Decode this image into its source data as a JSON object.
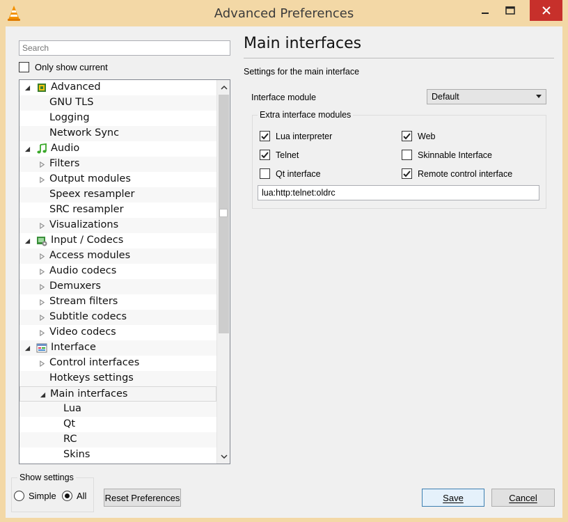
{
  "window": {
    "title": "Advanced Preferences",
    "colors": {
      "frame": "#f3d8a6",
      "close": "#c7302b",
      "accent": "#3c7fb1"
    }
  },
  "left": {
    "search_placeholder": "Search",
    "only_show_current": {
      "label": "Only show current",
      "checked": false
    },
    "tree": [
      {
        "label": "Advanced",
        "level": 0,
        "expanded": true,
        "icon": "chip-icon"
      },
      {
        "label": "GNU TLS",
        "level": 1
      },
      {
        "label": "Logging",
        "level": 1
      },
      {
        "label": "Network Sync",
        "level": 1
      },
      {
        "label": "Audio",
        "level": 0,
        "expanded": true,
        "icon": "music-note-icon"
      },
      {
        "label": "Filters",
        "level": 1,
        "collapsed": true
      },
      {
        "label": "Output modules",
        "level": 1,
        "collapsed": true
      },
      {
        "label": "Speex resampler",
        "level": 1
      },
      {
        "label": "SRC resampler",
        "level": 1
      },
      {
        "label": "Visualizations",
        "level": 1,
        "collapsed": true
      },
      {
        "label": "Input / Codecs",
        "level": 0,
        "expanded": true,
        "icon": "codec-icon"
      },
      {
        "label": "Access modules",
        "level": 1,
        "collapsed": true
      },
      {
        "label": "Audio codecs",
        "level": 1,
        "collapsed": true
      },
      {
        "label": "Demuxers",
        "level": 1,
        "collapsed": true
      },
      {
        "label": "Stream filters",
        "level": 1,
        "collapsed": true
      },
      {
        "label": "Subtitle codecs",
        "level": 1,
        "collapsed": true
      },
      {
        "label": "Video codecs",
        "level": 1,
        "collapsed": true
      },
      {
        "label": "Interface",
        "level": 0,
        "expanded": true,
        "icon": "interface-icon"
      },
      {
        "label": "Control interfaces",
        "level": 1,
        "collapsed": true
      },
      {
        "label": "Hotkeys settings",
        "level": 1
      },
      {
        "label": "Main interfaces",
        "level": 1,
        "expanded": true,
        "selected": true
      },
      {
        "label": "Lua",
        "level": 2
      },
      {
        "label": "Qt",
        "level": 2
      },
      {
        "label": "RC",
        "level": 2
      },
      {
        "label": "Skins",
        "level": 2
      }
    ],
    "show_settings": {
      "legend": "Show settings",
      "simple": {
        "label": "Simple",
        "selected": false
      },
      "all": {
        "label": "All",
        "selected": true
      }
    },
    "reset_button": "Reset Preferences"
  },
  "right": {
    "title": "Main interfaces",
    "subtitle": "Settings for the main interface",
    "interface_module": {
      "label": "Interface module",
      "value": "Default"
    },
    "extra": {
      "legend": "Extra interface modules",
      "options": [
        {
          "label": "Lua interpreter",
          "checked": true
        },
        {
          "label": "Web",
          "checked": true
        },
        {
          "label": "Telnet",
          "checked": true
        },
        {
          "label": "Skinnable Interface",
          "checked": false
        },
        {
          "label": "Qt interface",
          "checked": false
        },
        {
          "label": "Remote control interface",
          "checked": true
        }
      ],
      "modules_value": "lua:http:telnet:oldrc"
    }
  },
  "footer": {
    "save": "Save",
    "cancel": "Cancel"
  }
}
